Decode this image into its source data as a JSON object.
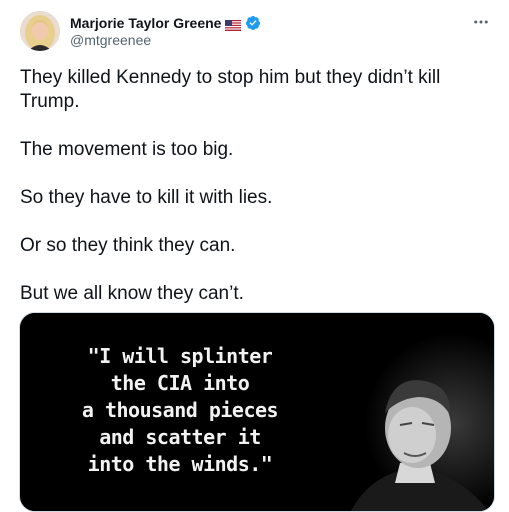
{
  "author": {
    "display_name": "Marjorie Taylor Greene",
    "flag_icon": "us-flag-icon",
    "verified_icon": "verified-badge-icon",
    "handle": "@mtgreenee"
  },
  "menu": {
    "icon": "more-horizontal-icon"
  },
  "tweet": {
    "paragraphs": [
      "They killed Kennedy to stop him but they didn’t kill Trump.",
      "The movement is too big.",
      "So they have to kill it with lies.",
      "Or so they think they can.",
      "But we all know they can’t."
    ]
  },
  "media": {
    "quote_lines": [
      "\"I will splinter",
      "the CIA into",
      "a thousand pieces",
      "and scatter it",
      "into the winds.\""
    ]
  },
  "colors": {
    "text": "#0f1419",
    "secondary": "#536471",
    "verified": "#1d9bf0",
    "media_bg": "#000000"
  }
}
